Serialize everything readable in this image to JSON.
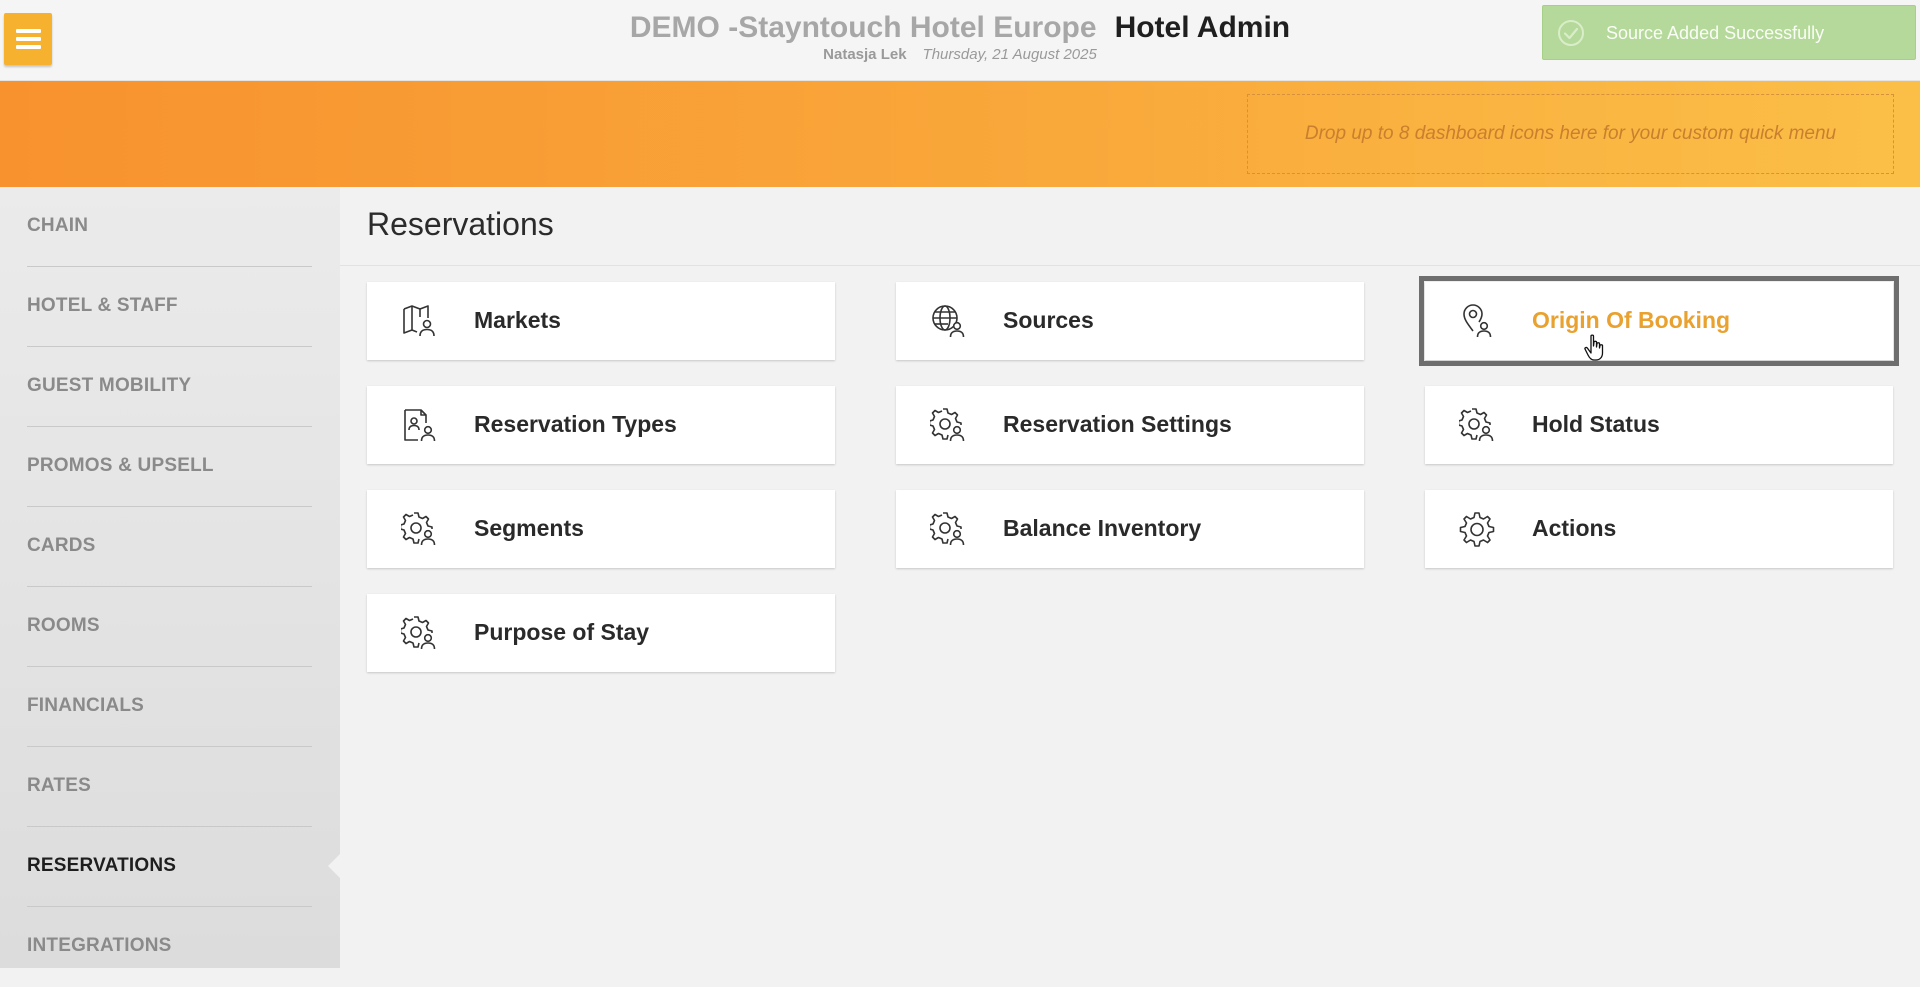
{
  "header": {
    "hotel_name": "DEMO -Stayntouch Hotel Europe",
    "app_title": "Hotel Admin",
    "user_name": "Natasja Lek",
    "date": "Thursday, 21 August 2025"
  },
  "toast": {
    "message": "Source Added Successfully",
    "color": "#b5d99a"
  },
  "quick_menu": {
    "placeholder": "Drop up to 8 dashboard icons here for your custom quick menu"
  },
  "colors": {
    "accent": "#f6b22e",
    "band_start": "#f8922f",
    "band_end": "#fbbf47",
    "selected_label": "#e9a12f"
  },
  "sidebar": {
    "items": [
      {
        "label": "CHAIN"
      },
      {
        "label": "HOTEL & STAFF"
      },
      {
        "label": "GUEST MOBILITY"
      },
      {
        "label": "PROMOS & UPSELL"
      },
      {
        "label": "CARDS"
      },
      {
        "label": "ROOMS"
      },
      {
        "label": "FINANCIALS"
      },
      {
        "label": "RATES"
      },
      {
        "label": "RESERVATIONS",
        "active": true
      },
      {
        "label": "INTEGRATIONS"
      }
    ]
  },
  "main": {
    "title": "Reservations",
    "cards": [
      {
        "label": "Markets",
        "icon": "map-user-icon"
      },
      {
        "label": "Sources",
        "icon": "globe-user-icon"
      },
      {
        "label": "Origin Of Booking",
        "icon": "location-user-icon",
        "selected": true
      },
      {
        "label": "Reservation Types",
        "icon": "document-user-icon"
      },
      {
        "label": "Reservation Settings",
        "icon": "gear-user-icon"
      },
      {
        "label": "Hold Status",
        "icon": "gear-user-icon"
      },
      {
        "label": "Segments",
        "icon": "gear-user-icon"
      },
      {
        "label": "Balance Inventory",
        "icon": "gear-user-icon"
      },
      {
        "label": "Actions",
        "icon": "gear-icon"
      },
      {
        "label": "Purpose of Stay",
        "icon": "gear-user-icon"
      }
    ]
  }
}
